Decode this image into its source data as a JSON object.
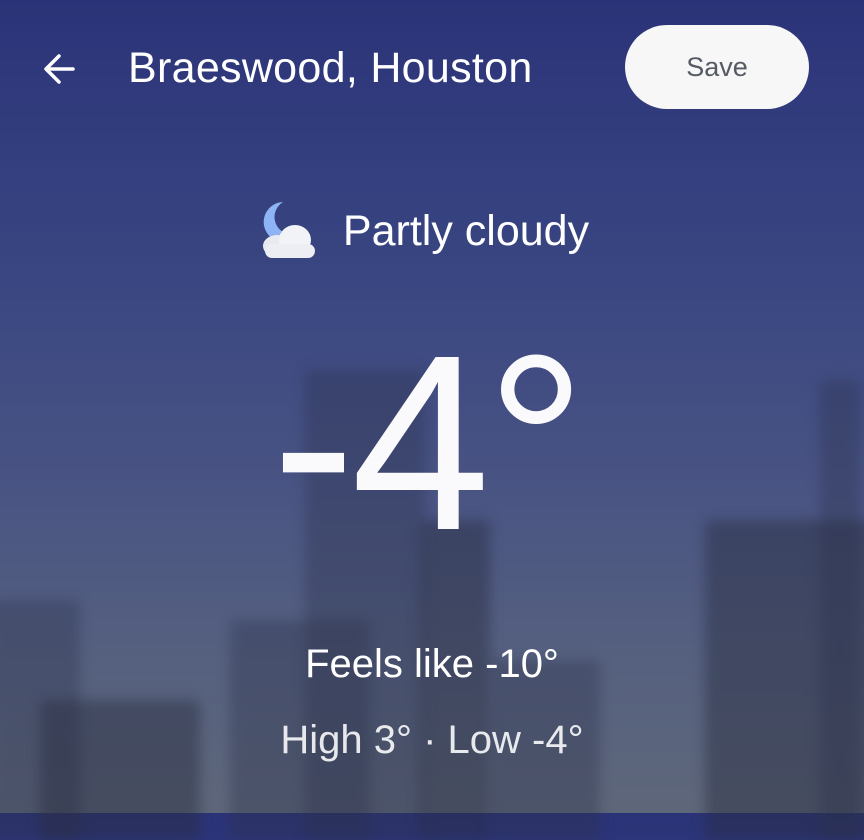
{
  "header": {
    "back_icon": "arrow-back-icon",
    "location": "Braeswood, Houston",
    "save_label": "Save"
  },
  "current": {
    "condition": "Partly cloudy",
    "condition_icon": "partly-cloudy-night-icon",
    "temperature": "-4°",
    "feels_like": "Feels like -10°",
    "high_low": "High 3° · Low -4°"
  },
  "colors": {
    "background_top": "#2b3378",
    "background_bottom": "#5e677a",
    "save_button_bg": "#f7f7f7",
    "save_button_text": "#555a63"
  }
}
